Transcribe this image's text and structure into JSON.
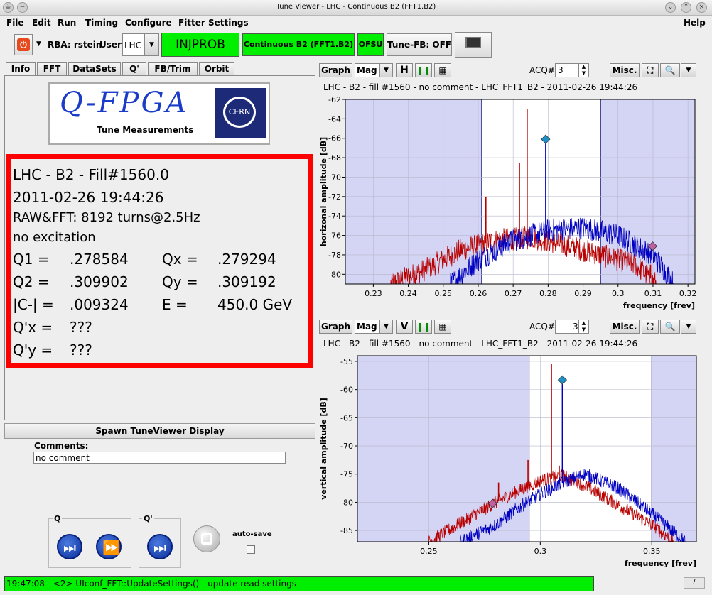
{
  "window": {
    "title": "Tune Viewer - LHC - Continuous B2 (FFT1.B2)"
  },
  "menu": [
    "File",
    "Edit",
    "Run",
    "Timing",
    "Configure",
    "Fitter Settings",
    "Help"
  ],
  "toolbar": {
    "rba": "RBA: rstein",
    "user_label": "User:",
    "user_value": "LHC",
    "injprob": "INJPROB",
    "mode": "Continuous B2 (FFT1.B2)",
    "ofsu": "OFSU",
    "tunefb": "Tune-FB: OFF"
  },
  "tabs": [
    "Info",
    "FFT",
    "DataSets",
    "Q'",
    "FB/Trim",
    "Orbit"
  ],
  "logo": {
    "name": "Q-FPGA",
    "subtitle": "Tune Measurements",
    "badge": "CERN"
  },
  "info": {
    "header": "LHC - B2 - Fill#1560.0",
    "timestamp": "2011-02-26 19:44:26",
    "raw": "RAW&FFT: 8192 turns@2.5Hz",
    "excitation": "no excitation",
    "rows": [
      {
        "k1": "Q1 =",
        "v1": ".278584",
        "k2": "Qx =",
        "v2": ".279294"
      },
      {
        "k1": "Q2 =",
        "v1": ".309902",
        "k2": "Qy =",
        "v2": ".309192"
      },
      {
        "k1": "|C-| =",
        "v1": ".009324",
        "k2": "E =",
        "v2": "450.0 GeV"
      },
      {
        "k1": "Q'x =",
        "v1": "???",
        "k2": "",
        "v2": ""
      },
      {
        "k1": "Q'y =",
        "v1": "???",
        "k2": "",
        "v2": ""
      }
    ]
  },
  "spawn_label": "Spawn TuneViewer Display",
  "comments": {
    "label": "Comments:",
    "value": "no comment"
  },
  "groups": {
    "q": "Q",
    "qprime": "Q'",
    "autosave": "auto-save"
  },
  "status": "19:47:08 - <2> UIconf_FFT::UpdateSettings() - update read settings",
  "graph_controls": {
    "graph": "Graph",
    "mag": "Mag",
    "acq_label": "ACQ#",
    "acq_value": "3",
    "misc": "Misc.",
    "h": "H",
    "v": "V"
  },
  "colors": {
    "red_series": "#b80000",
    "blue_series": "#0000c0",
    "band": "#d4d4f4",
    "marker_blue": "#1e90c8",
    "marker_pink": "#c060a0"
  },
  "chart_data": [
    {
      "type": "line",
      "subtitle": "LHC - B2 - fill #1560 - no comment - LHC_FFT1_B2 - 2011-02-26 19:44:26",
      "xlabel": "frequency [frev]",
      "ylabel": "horizonal amplitude [dB]",
      "xlim": [
        0.222,
        0.322
      ],
      "ylim": [
        -81,
        -62
      ],
      "xticks": [
        0.23,
        0.24,
        0.25,
        0.26,
        0.27,
        0.28,
        0.29,
        0.3,
        0.31,
        0.32
      ],
      "xtick_labels": [
        "0.23",
        "0.24",
        "0.25",
        "0.26",
        "0.27",
        "0.28",
        "0.29",
        "0.3",
        "0.31",
        "0.32"
      ],
      "yticks": [
        -62,
        -64,
        -66,
        -68,
        -70,
        -72,
        -74,
        -76,
        -78,
        -80
      ],
      "ytick_labels": [
        "-62",
        "-64",
        "-66",
        "-68",
        "-70",
        "-72",
        "-74",
        "-76",
        "-78",
        "-80"
      ],
      "bands": [
        [
          0.222,
          0.261
        ],
        [
          0.295,
          0.322
        ]
      ],
      "series": [
        {
          "color": "#b80000",
          "x": [
            0.235,
            0.245,
            0.255,
            0.265,
            0.275,
            0.285,
            0.295,
            0.305,
            0.311
          ],
          "y": [
            -81,
            -79.5,
            -77.5,
            -76.5,
            -76.2,
            -77,
            -78,
            -79,
            -81
          ],
          "peaks": [
            [
              0.2622,
              -72
            ],
            [
              0.2718,
              -68.5
            ],
            [
              0.274,
              -63
            ],
            [
              0.2815,
              -77
            ],
            [
              0.3093,
              -79
            ]
          ]
        },
        {
          "color": "#0000c0",
          "x": [
            0.252,
            0.26,
            0.27,
            0.28,
            0.29,
            0.3,
            0.31,
            0.316
          ],
          "y": [
            -81,
            -78.5,
            -76.5,
            -75.5,
            -75.2,
            -76,
            -78,
            -81
          ],
          "peaks": [
            [
              0.2793,
              -66.1
            ],
            [
              0.2665,
              -76.5
            ],
            [
              0.2875,
              -75
            ]
          ]
        }
      ],
      "markers": [
        {
          "x": 0.2793,
          "y": -66.1,
          "color": "#1e90c8"
        },
        {
          "x": 0.3099,
          "y": -77.1,
          "color": "#c060a0"
        }
      ]
    },
    {
      "type": "line",
      "subtitle": "LHC - B2 - fill #1560 - no comment - LHC_FFT1_B2 - 2011-02-26 19:44:26",
      "xlabel": "frequency [frev]",
      "ylabel": "vertical amplitude [dB]",
      "xlim": [
        0.218,
        0.37
      ],
      "ylim": [
        -87,
        -54
      ],
      "xticks": [
        0.25,
        0.3,
        0.35
      ],
      "xtick_labels": [
        "0.25",
        "0.3",
        "0.35"
      ],
      "yticks": [
        -55,
        -60,
        -65,
        -70,
        -75,
        -80,
        -85
      ],
      "ytick_labels": [
        "-55",
        "-60",
        "-65",
        "-70",
        "-75",
        "-80",
        "-85"
      ],
      "bands": [
        [
          0.218,
          0.295
        ],
        [
          0.35,
          0.37
        ]
      ],
      "series": [
        {
          "color": "#b80000",
          "x": [
            0.25,
            0.265,
            0.28,
            0.29,
            0.3,
            0.31,
            0.32,
            0.335,
            0.35,
            0.36
          ],
          "y": [
            -87,
            -83.5,
            -80,
            -78,
            -76.2,
            -75.2,
            -77,
            -80.5,
            -84,
            -87
          ],
          "peaks": [
            [
              0.2813,
              -76.5
            ],
            [
              0.2945,
              -72.5
            ],
            [
              0.305,
              -55.5
            ],
            [
              0.3085,
              -73.5
            ]
          ]
        },
        {
          "color": "#0000c0",
          "x": [
            0.264,
            0.28,
            0.29,
            0.3,
            0.31,
            0.32,
            0.335,
            0.35,
            0.365
          ],
          "y": [
            -87,
            -84,
            -81,
            -78.5,
            -76.5,
            -75,
            -77.5,
            -82,
            -87
          ],
          "peaks": [
            [
              0.3099,
              -58.3
            ]
          ]
        }
      ],
      "markers": [
        {
          "x": 0.3099,
          "y": -58.3,
          "color": "#1e90c8"
        },
        {
          "x": 0.2786,
          "y": -80.2,
          "color": "#c060a0"
        }
      ]
    }
  ]
}
